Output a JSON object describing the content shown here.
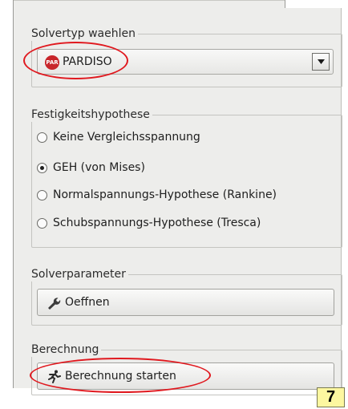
{
  "solver_group": {
    "title": "Solvertyp waehlen",
    "selected": "PARDISO",
    "selected_icon": "par-icon",
    "icon_text": "PAR"
  },
  "hypothesis_group": {
    "title": "Festigkeitshypothese",
    "options": [
      {
        "label": "Keine Vergleichsspannung",
        "checked": false
      },
      {
        "label": "GEH (von Mises)",
        "checked": true
      },
      {
        "label": "Normalspannungs-Hypothese (Rankine)",
        "checked": false
      },
      {
        "label": "Schubspannungs-Hypothese (Tresca)",
        "checked": false
      }
    ]
  },
  "solverparam_group": {
    "title": "Solverparameter",
    "button_label": "Oeffnen",
    "button_icon": "wrench-icon"
  },
  "calc_group": {
    "title": "Berechnung",
    "button_label": "Berechnung starten",
    "button_icon": "running-man-icon"
  },
  "step_badge": "7",
  "annotation_color": "#e0191f",
  "badge_color": "#fdf7a0"
}
